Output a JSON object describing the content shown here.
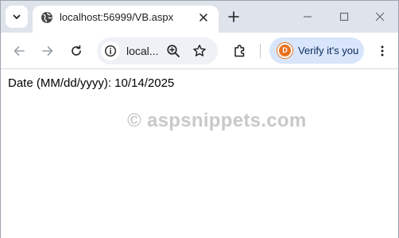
{
  "browser": {
    "tab": {
      "title": "localhost:56999/VB.aspx"
    },
    "omnibox": {
      "url_display": "local..."
    },
    "profile": {
      "initial": "D",
      "label": "Verify it's you",
      "avatar_color": "#e8711d"
    },
    "icons": {
      "tab_search": "chevron-down-icon",
      "favicon": "globe-icon",
      "tab_close": "close-icon",
      "new_tab": "plus-icon",
      "minimize": "minimize-icon",
      "maximize": "maximize-icon",
      "window_close": "close-icon",
      "back": "arrow-left-icon",
      "forward": "arrow-right-icon",
      "reload": "reload-icon",
      "site_info": "info-icon",
      "zoom": "zoom-in-icon",
      "bookmark": "star-icon",
      "extensions": "puzzle-icon",
      "menu": "more-vertical-icon"
    },
    "colors": {
      "tabstrip_bg": "#dfe3eb",
      "omnibox_bg": "#eef1f5",
      "profile_pill_bg": "#d8e5fb"
    }
  },
  "page": {
    "date_text": "Date (MM/dd/yyyy): 10/14/2025",
    "watermark": "© aspsnippets.com"
  }
}
